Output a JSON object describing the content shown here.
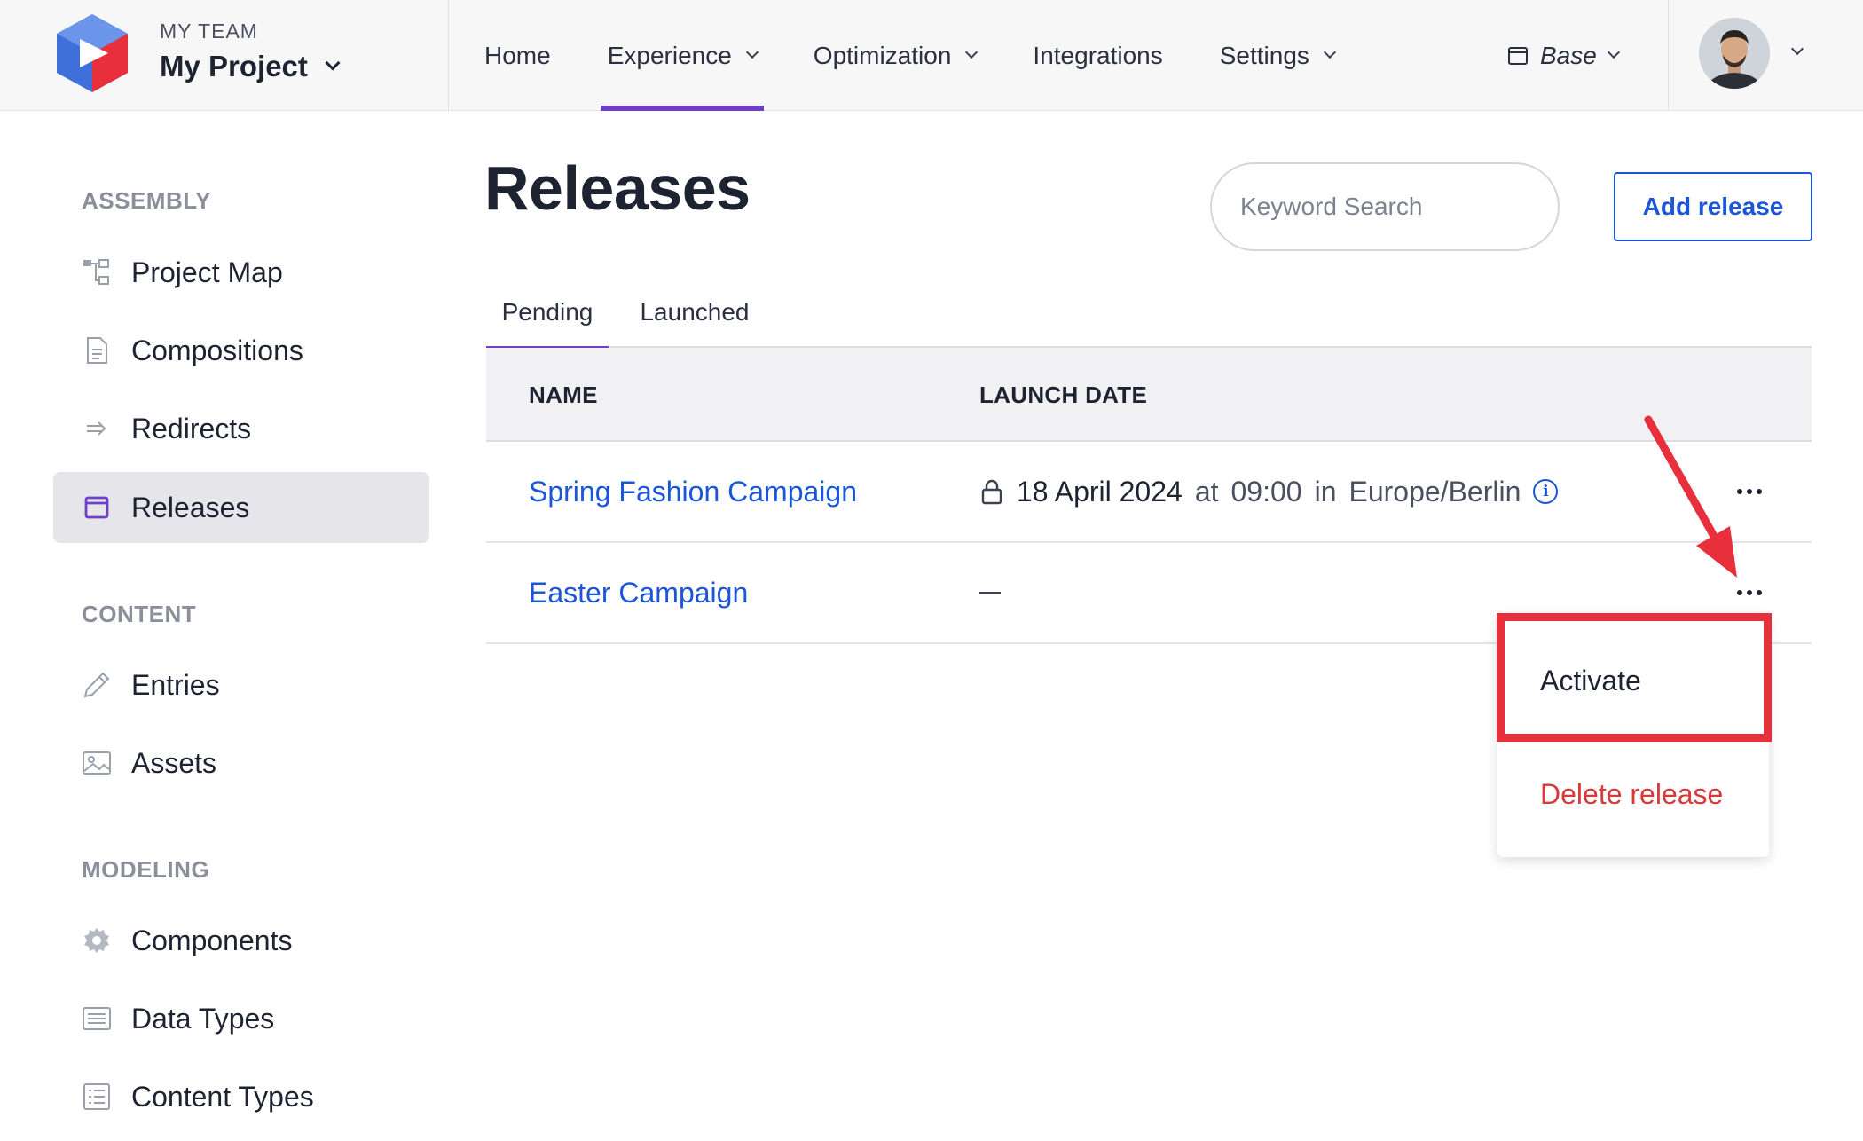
{
  "brand": {
    "team": "MY TEAM",
    "project": "My Project"
  },
  "nav": {
    "items": [
      {
        "label": "Home"
      },
      {
        "label": "Experience"
      },
      {
        "label": "Optimization"
      },
      {
        "label": "Integrations"
      },
      {
        "label": "Settings"
      }
    ],
    "active": "Experience",
    "environment": "Base"
  },
  "sidebar": {
    "sections": [
      {
        "title": "ASSEMBLY",
        "items": [
          {
            "label": "Project Map",
            "icon": "project-map-icon"
          },
          {
            "label": "Compositions",
            "icon": "document-icon"
          },
          {
            "label": "Redirects",
            "icon": "redirect-arrow-icon"
          },
          {
            "label": "Releases",
            "icon": "calendar-icon",
            "active": true
          }
        ]
      },
      {
        "title": "CONTENT",
        "items": [
          {
            "label": "Entries",
            "icon": "pencil-icon"
          },
          {
            "label": "Assets",
            "icon": "image-icon"
          }
        ]
      },
      {
        "title": "MODELING",
        "items": [
          {
            "label": "Components",
            "icon": "gear-icon"
          },
          {
            "label": "Data Types",
            "icon": "data-list-icon"
          },
          {
            "label": "Content Types",
            "icon": "list-icon"
          }
        ]
      }
    ]
  },
  "main": {
    "title": "Releases",
    "search_placeholder": "Keyword Search",
    "add_button": "Add release",
    "tabs": [
      {
        "label": "Pending",
        "active": true
      },
      {
        "label": "Launched",
        "active": false
      }
    ],
    "columns": [
      "NAME",
      "LAUNCH DATE"
    ],
    "rows": [
      {
        "name": "Spring Fashion Campaign",
        "date": "18 April 2024",
        "at": "at",
        "time": "09:00",
        "in": "in",
        "timezone": "Europe/Berlin",
        "locked": true
      },
      {
        "name": "Easter Campaign",
        "date": null,
        "locked": false
      }
    ]
  },
  "menu": {
    "items": [
      {
        "label": "Activate",
        "color": "#1d2330"
      },
      {
        "label": "Delete release",
        "color": "#d63a3a"
      }
    ]
  },
  "colors": {
    "accent": "#6f3fc9",
    "link": "#1b56d8",
    "danger": "#d63a3a",
    "annotation": "#e8303c"
  }
}
